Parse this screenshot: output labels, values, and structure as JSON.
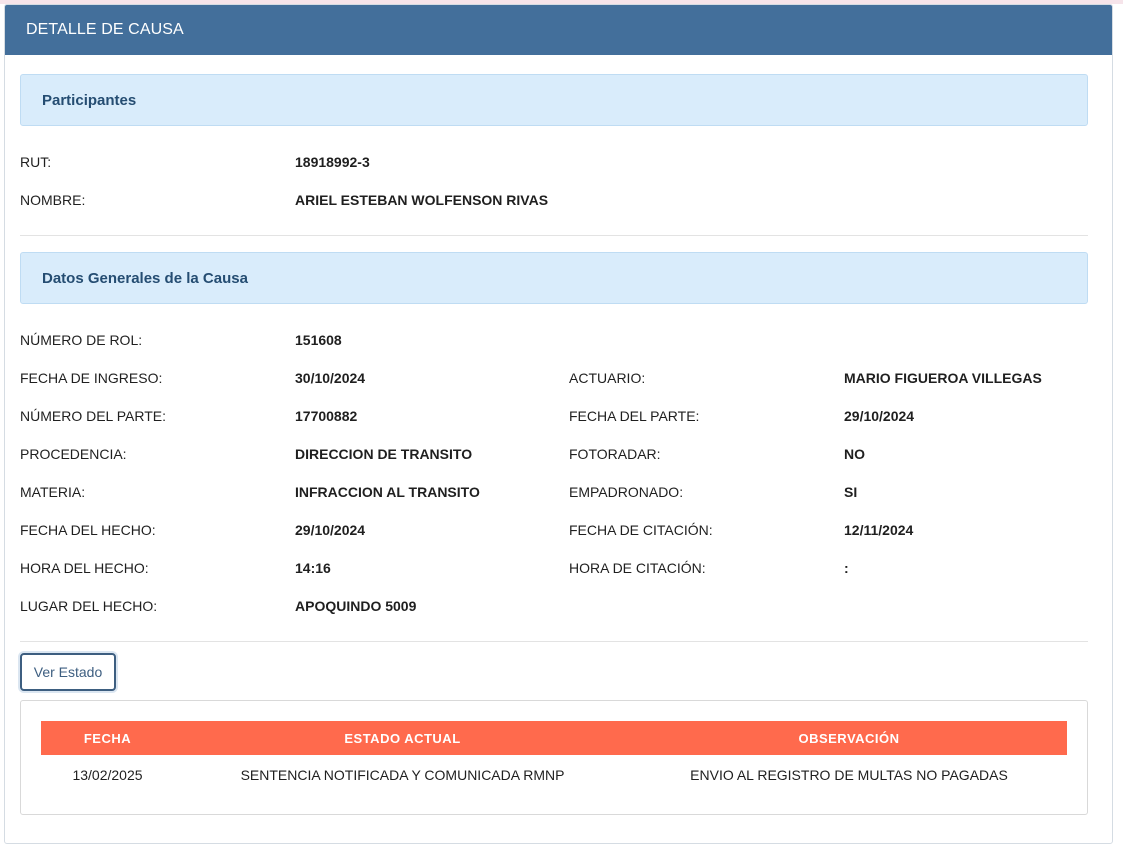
{
  "panel": {
    "title": "DETALLE DE CAUSA"
  },
  "participantes": {
    "title": "Participantes",
    "rows": [
      {
        "label": "RUT:",
        "value": "18918992-3"
      },
      {
        "label": "NOMBRE:",
        "value": "ARIEL ESTEBAN WOLFENSON RIVAS"
      }
    ]
  },
  "datos": {
    "title": "Datos Generales de la Causa",
    "rows": [
      {
        "label": "NÚMERO DE ROL:",
        "value": "151608",
        "label2": "",
        "value2": ""
      },
      {
        "label": "FECHA DE INGRESO:",
        "value": "30/10/2024",
        "label2": "ACTUARIO:",
        "value2": "MARIO FIGUEROA VILLEGAS"
      },
      {
        "label": "NÚMERO DEL PARTE:",
        "value": "17700882",
        "label2": "FECHA DEL PARTE:",
        "value2": "29/10/2024"
      },
      {
        "label": "PROCEDENCIA:",
        "value": "DIRECCION DE TRANSITO",
        "label2": "FOTORADAR:",
        "value2": "NO"
      },
      {
        "label": "MATERIA:",
        "value": "INFRACCION AL TRANSITO",
        "label2": "EMPADRONADO:",
        "value2": "SI"
      },
      {
        "label": "FECHA DEL HECHO:",
        "value": "29/10/2024",
        "label2": "FECHA DE CITACIÓN:",
        "value2": "12/11/2024"
      },
      {
        "label": "HORA DEL HECHO:",
        "value": "14:16",
        "label2": "HORA DE CITACIÓN:",
        "value2": ":"
      },
      {
        "label": "LUGAR DEL HECHO:",
        "value": "APOQUINDO 5009",
        "label2": "",
        "value2": ""
      }
    ]
  },
  "ver_estado": {
    "label": "Ver Estado"
  },
  "estado_table": {
    "headers": [
      "FECHA",
      "ESTADO ACTUAL",
      "OBSERVACIÓN"
    ],
    "rows": [
      [
        "13/02/2025",
        "SENTENCIA NOTIFICADA Y COMUNICADA RMNP",
        "ENVIO AL REGISTRO DE MULTAS NO PAGADAS"
      ]
    ]
  },
  "colors": {
    "header": "#436f9b",
    "section_bg": "#d9ecfb",
    "section_text": "#254d72",
    "table_header": "#ff6a4d"
  }
}
